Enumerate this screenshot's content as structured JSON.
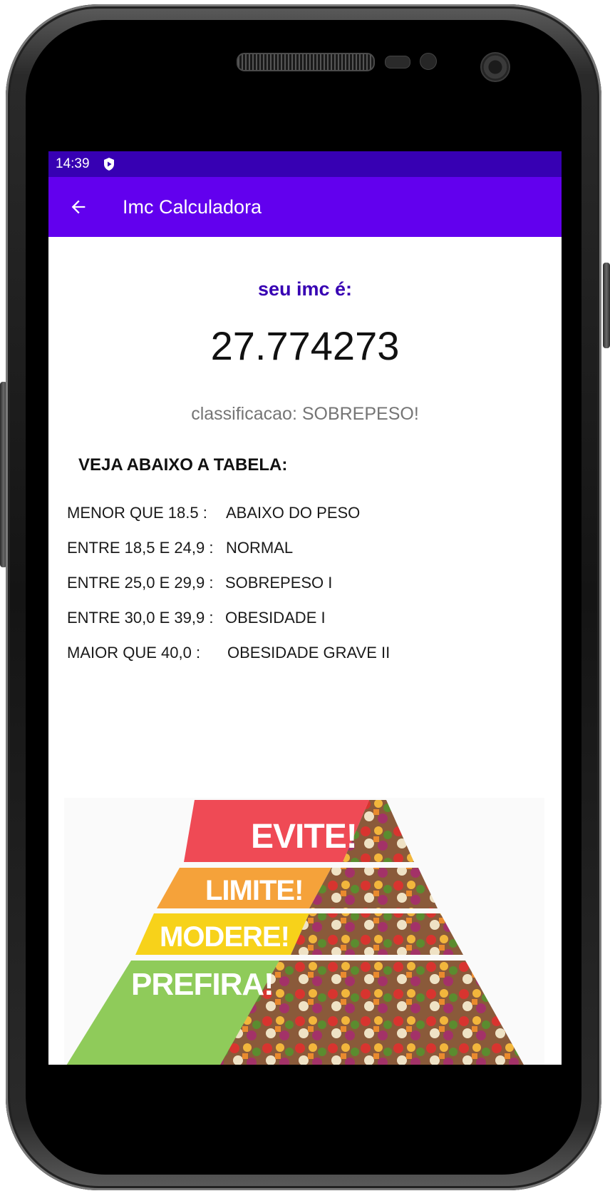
{
  "status_bar": {
    "time": "14:39",
    "icons": [
      "shield-play-icon"
    ]
  },
  "app_bar": {
    "title": "Imc Calculadora",
    "back_icon": "arrow-back-icon"
  },
  "result": {
    "label": "seu imc é:",
    "value": "27.774273",
    "classification": "classificacao: SOBREPESO!"
  },
  "table": {
    "title": "VEJA ABAIXO A TABELA:",
    "rows": [
      {
        "range": "MENOR QUE 18.5 :",
        "class": "ABAIXO DO PESO"
      },
      {
        "range": "ENTRE 18,5 E 24,9 :",
        "class": "NORMAL"
      },
      {
        "range": "ENTRE 25,0 E 29,9 :",
        "class": "SOBREPESO I"
      },
      {
        "range": "ENTRE 30,0 E 39,9 :",
        "class": "OBESIDADE I"
      },
      {
        "range": "MAIOR QUE 40,0 :",
        "class": "OBESIDADE GRAVE II"
      }
    ]
  },
  "pyramid": {
    "levels": [
      {
        "label": "EVITE!",
        "color": "#ef4a55"
      },
      {
        "label": "LIMITE!",
        "color": "#f5a23a"
      },
      {
        "label": "MODERE!",
        "color": "#f7d21a"
      },
      {
        "label": "PREFIRA!",
        "color": "#8fcb5a"
      }
    ]
  },
  "colors": {
    "status_bar": "#3700b3",
    "app_bar": "#6200ee",
    "accent_text": "#3700b3"
  }
}
